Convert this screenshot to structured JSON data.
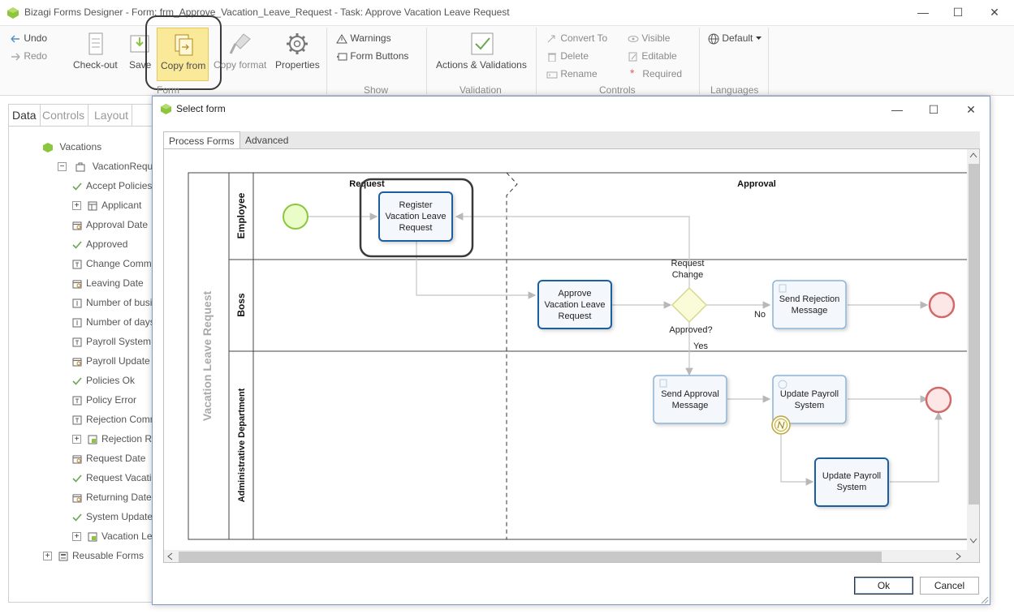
{
  "app": {
    "title": "Bizagi Forms Designer  -  Form: frm_Approve_Vacation_Leave_Request - Task:  Approve Vacation Leave Request",
    "controls": {
      "minimize": "—",
      "maximize": "☐",
      "close": "✕"
    }
  },
  "ribbon": {
    "undo": "Undo",
    "redo": "Redo",
    "checkout": "Check-out",
    "save": "Save",
    "copy_from": "Copy from",
    "copy_format": "Copy format",
    "properties": "Properties",
    "form_group": "Form",
    "warnings": "Warnings",
    "form_buttons": "Form Buttons",
    "show_group": "Show",
    "actions_validations": "Actions & Validations",
    "validation_group": "Validation",
    "convert_to": "Convert To",
    "delete": "Delete",
    "rename": "Rename",
    "visible": "Visible",
    "editable": "Editable",
    "required": "Required",
    "required_mark": "*",
    "controls_group": "Controls",
    "language": "Default",
    "languages_group": "Languages"
  },
  "left_panel": {
    "tabs": [
      "Data",
      "Controls",
      "Layout"
    ],
    "root": "Vacations",
    "entity": "VacationRequest",
    "items": [
      {
        "label": "Accept Policies",
        "icon": "check-icon"
      },
      {
        "label": "Applicant",
        "icon": "table-icon",
        "expandable": true
      },
      {
        "label": "Approval Date",
        "icon": "calendar-icon"
      },
      {
        "label": "Approved",
        "icon": "check-icon"
      },
      {
        "label": "Change Comments",
        "icon": "text-icon"
      },
      {
        "label": "Leaving Date",
        "icon": "calendar-icon"
      },
      {
        "label": "Number of business days",
        "icon": "number-icon"
      },
      {
        "label": "Number of days",
        "icon": "number-icon"
      },
      {
        "label": "Payroll System",
        "icon": "text-icon"
      },
      {
        "label": "Payroll Update",
        "icon": "calendar-icon"
      },
      {
        "label": "Policies Ok",
        "icon": "check-icon"
      },
      {
        "label": "Policy Error",
        "icon": "text-icon"
      },
      {
        "label": "Rejection Comments",
        "icon": "text-icon"
      },
      {
        "label": "Rejection Reason",
        "icon": "relation-icon",
        "expandable": true
      },
      {
        "label": "Request Date",
        "icon": "calendar-icon"
      },
      {
        "label": "Request Vacation",
        "icon": "check-icon"
      },
      {
        "label": "Returning Date",
        "icon": "calendar-icon"
      },
      {
        "label": "System Updated",
        "icon": "check-icon"
      },
      {
        "label": "Vacation Leave",
        "icon": "relation-icon",
        "expandable": true
      },
      {
        "label": "Reusable Forms",
        "icon": "form-icon",
        "expandable": true
      }
    ],
    "footer": "Reusable Forms"
  },
  "dialog": {
    "title": "Select form",
    "tabs": [
      "Process Forms",
      "Advanced"
    ],
    "ok": "Ok",
    "cancel": "Cancel",
    "diagram": {
      "pool": "Vacation Leave Request",
      "lanes": [
        "Employee",
        "Boss",
        "Administrative Department"
      ],
      "phases": [
        "Request",
        "Approval"
      ],
      "tasks": {
        "register": [
          "Register",
          "Vacation Leave",
          "Request"
        ],
        "approve": [
          "Approve",
          "Vacation Leave",
          "Request"
        ],
        "send_rejection": [
          "Send Rejection",
          "Message"
        ],
        "send_approval": [
          "Send Approval",
          "Message"
        ],
        "update_payroll": [
          "Update Payroll",
          "System"
        ],
        "update_payroll_2": [
          "Update Payroll",
          "System"
        ]
      },
      "gateway_label": "Approved?",
      "flows": {
        "request_change": [
          "Request",
          "Change"
        ],
        "no": "No",
        "yes": "Yes"
      }
    }
  }
}
